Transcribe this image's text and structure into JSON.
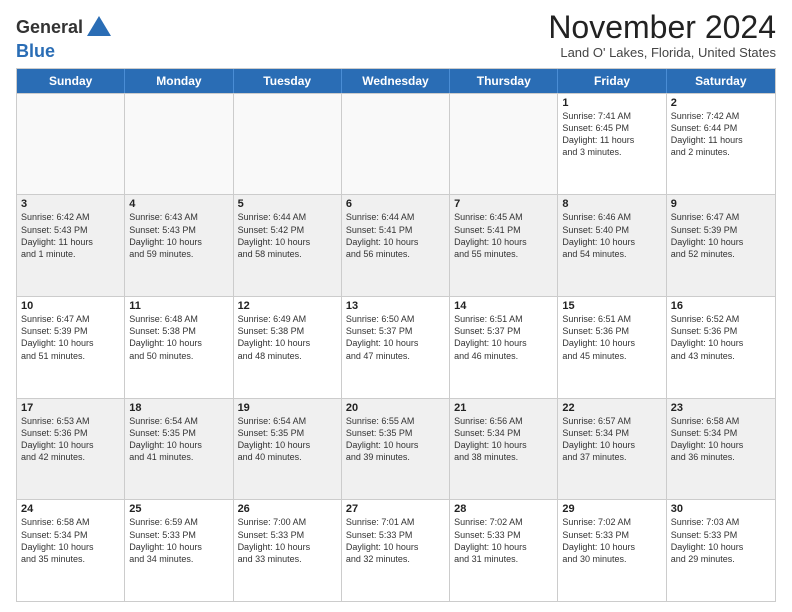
{
  "header": {
    "logo_line1": "General",
    "logo_line2": "Blue",
    "month_title": "November 2024",
    "location": "Land O' Lakes, Florida, United States"
  },
  "weekdays": [
    "Sunday",
    "Monday",
    "Tuesday",
    "Wednesday",
    "Thursday",
    "Friday",
    "Saturday"
  ],
  "weeks": [
    [
      {
        "day": "",
        "info": "",
        "empty": true
      },
      {
        "day": "",
        "info": "",
        "empty": true
      },
      {
        "day": "",
        "info": "",
        "empty": true
      },
      {
        "day": "",
        "info": "",
        "empty": true
      },
      {
        "day": "",
        "info": "",
        "empty": true
      },
      {
        "day": "1",
        "info": "Sunrise: 7:41 AM\nSunset: 6:45 PM\nDaylight: 11 hours\nand 3 minutes.",
        "empty": false
      },
      {
        "day": "2",
        "info": "Sunrise: 7:42 AM\nSunset: 6:44 PM\nDaylight: 11 hours\nand 2 minutes.",
        "empty": false
      }
    ],
    [
      {
        "day": "3",
        "info": "Sunrise: 6:42 AM\nSunset: 5:43 PM\nDaylight: 11 hours\nand 1 minute.",
        "empty": false
      },
      {
        "day": "4",
        "info": "Sunrise: 6:43 AM\nSunset: 5:43 PM\nDaylight: 10 hours\nand 59 minutes.",
        "empty": false
      },
      {
        "day": "5",
        "info": "Sunrise: 6:44 AM\nSunset: 5:42 PM\nDaylight: 10 hours\nand 58 minutes.",
        "empty": false
      },
      {
        "day": "6",
        "info": "Sunrise: 6:44 AM\nSunset: 5:41 PM\nDaylight: 10 hours\nand 56 minutes.",
        "empty": false
      },
      {
        "day": "7",
        "info": "Sunrise: 6:45 AM\nSunset: 5:41 PM\nDaylight: 10 hours\nand 55 minutes.",
        "empty": false
      },
      {
        "day": "8",
        "info": "Sunrise: 6:46 AM\nSunset: 5:40 PM\nDaylight: 10 hours\nand 54 minutes.",
        "empty": false
      },
      {
        "day": "9",
        "info": "Sunrise: 6:47 AM\nSunset: 5:39 PM\nDaylight: 10 hours\nand 52 minutes.",
        "empty": false
      }
    ],
    [
      {
        "day": "10",
        "info": "Sunrise: 6:47 AM\nSunset: 5:39 PM\nDaylight: 10 hours\nand 51 minutes.",
        "empty": false
      },
      {
        "day": "11",
        "info": "Sunrise: 6:48 AM\nSunset: 5:38 PM\nDaylight: 10 hours\nand 50 minutes.",
        "empty": false
      },
      {
        "day": "12",
        "info": "Sunrise: 6:49 AM\nSunset: 5:38 PM\nDaylight: 10 hours\nand 48 minutes.",
        "empty": false
      },
      {
        "day": "13",
        "info": "Sunrise: 6:50 AM\nSunset: 5:37 PM\nDaylight: 10 hours\nand 47 minutes.",
        "empty": false
      },
      {
        "day": "14",
        "info": "Sunrise: 6:51 AM\nSunset: 5:37 PM\nDaylight: 10 hours\nand 46 minutes.",
        "empty": false
      },
      {
        "day": "15",
        "info": "Sunrise: 6:51 AM\nSunset: 5:36 PM\nDaylight: 10 hours\nand 45 minutes.",
        "empty": false
      },
      {
        "day": "16",
        "info": "Sunrise: 6:52 AM\nSunset: 5:36 PM\nDaylight: 10 hours\nand 43 minutes.",
        "empty": false
      }
    ],
    [
      {
        "day": "17",
        "info": "Sunrise: 6:53 AM\nSunset: 5:36 PM\nDaylight: 10 hours\nand 42 minutes.",
        "empty": false
      },
      {
        "day": "18",
        "info": "Sunrise: 6:54 AM\nSunset: 5:35 PM\nDaylight: 10 hours\nand 41 minutes.",
        "empty": false
      },
      {
        "day": "19",
        "info": "Sunrise: 6:54 AM\nSunset: 5:35 PM\nDaylight: 10 hours\nand 40 minutes.",
        "empty": false
      },
      {
        "day": "20",
        "info": "Sunrise: 6:55 AM\nSunset: 5:35 PM\nDaylight: 10 hours\nand 39 minutes.",
        "empty": false
      },
      {
        "day": "21",
        "info": "Sunrise: 6:56 AM\nSunset: 5:34 PM\nDaylight: 10 hours\nand 38 minutes.",
        "empty": false
      },
      {
        "day": "22",
        "info": "Sunrise: 6:57 AM\nSunset: 5:34 PM\nDaylight: 10 hours\nand 37 minutes.",
        "empty": false
      },
      {
        "day": "23",
        "info": "Sunrise: 6:58 AM\nSunset: 5:34 PM\nDaylight: 10 hours\nand 36 minutes.",
        "empty": false
      }
    ],
    [
      {
        "day": "24",
        "info": "Sunrise: 6:58 AM\nSunset: 5:34 PM\nDaylight: 10 hours\nand 35 minutes.",
        "empty": false
      },
      {
        "day": "25",
        "info": "Sunrise: 6:59 AM\nSunset: 5:33 PM\nDaylight: 10 hours\nand 34 minutes.",
        "empty": false
      },
      {
        "day": "26",
        "info": "Sunrise: 7:00 AM\nSunset: 5:33 PM\nDaylight: 10 hours\nand 33 minutes.",
        "empty": false
      },
      {
        "day": "27",
        "info": "Sunrise: 7:01 AM\nSunset: 5:33 PM\nDaylight: 10 hours\nand 32 minutes.",
        "empty": false
      },
      {
        "day": "28",
        "info": "Sunrise: 7:02 AM\nSunset: 5:33 PM\nDaylight: 10 hours\nand 31 minutes.",
        "empty": false
      },
      {
        "day": "29",
        "info": "Sunrise: 7:02 AM\nSunset: 5:33 PM\nDaylight: 10 hours\nand 30 minutes.",
        "empty": false
      },
      {
        "day": "30",
        "info": "Sunrise: 7:03 AM\nSunset: 5:33 PM\nDaylight: 10 hours\nand 29 minutes.",
        "empty": false
      }
    ]
  ]
}
